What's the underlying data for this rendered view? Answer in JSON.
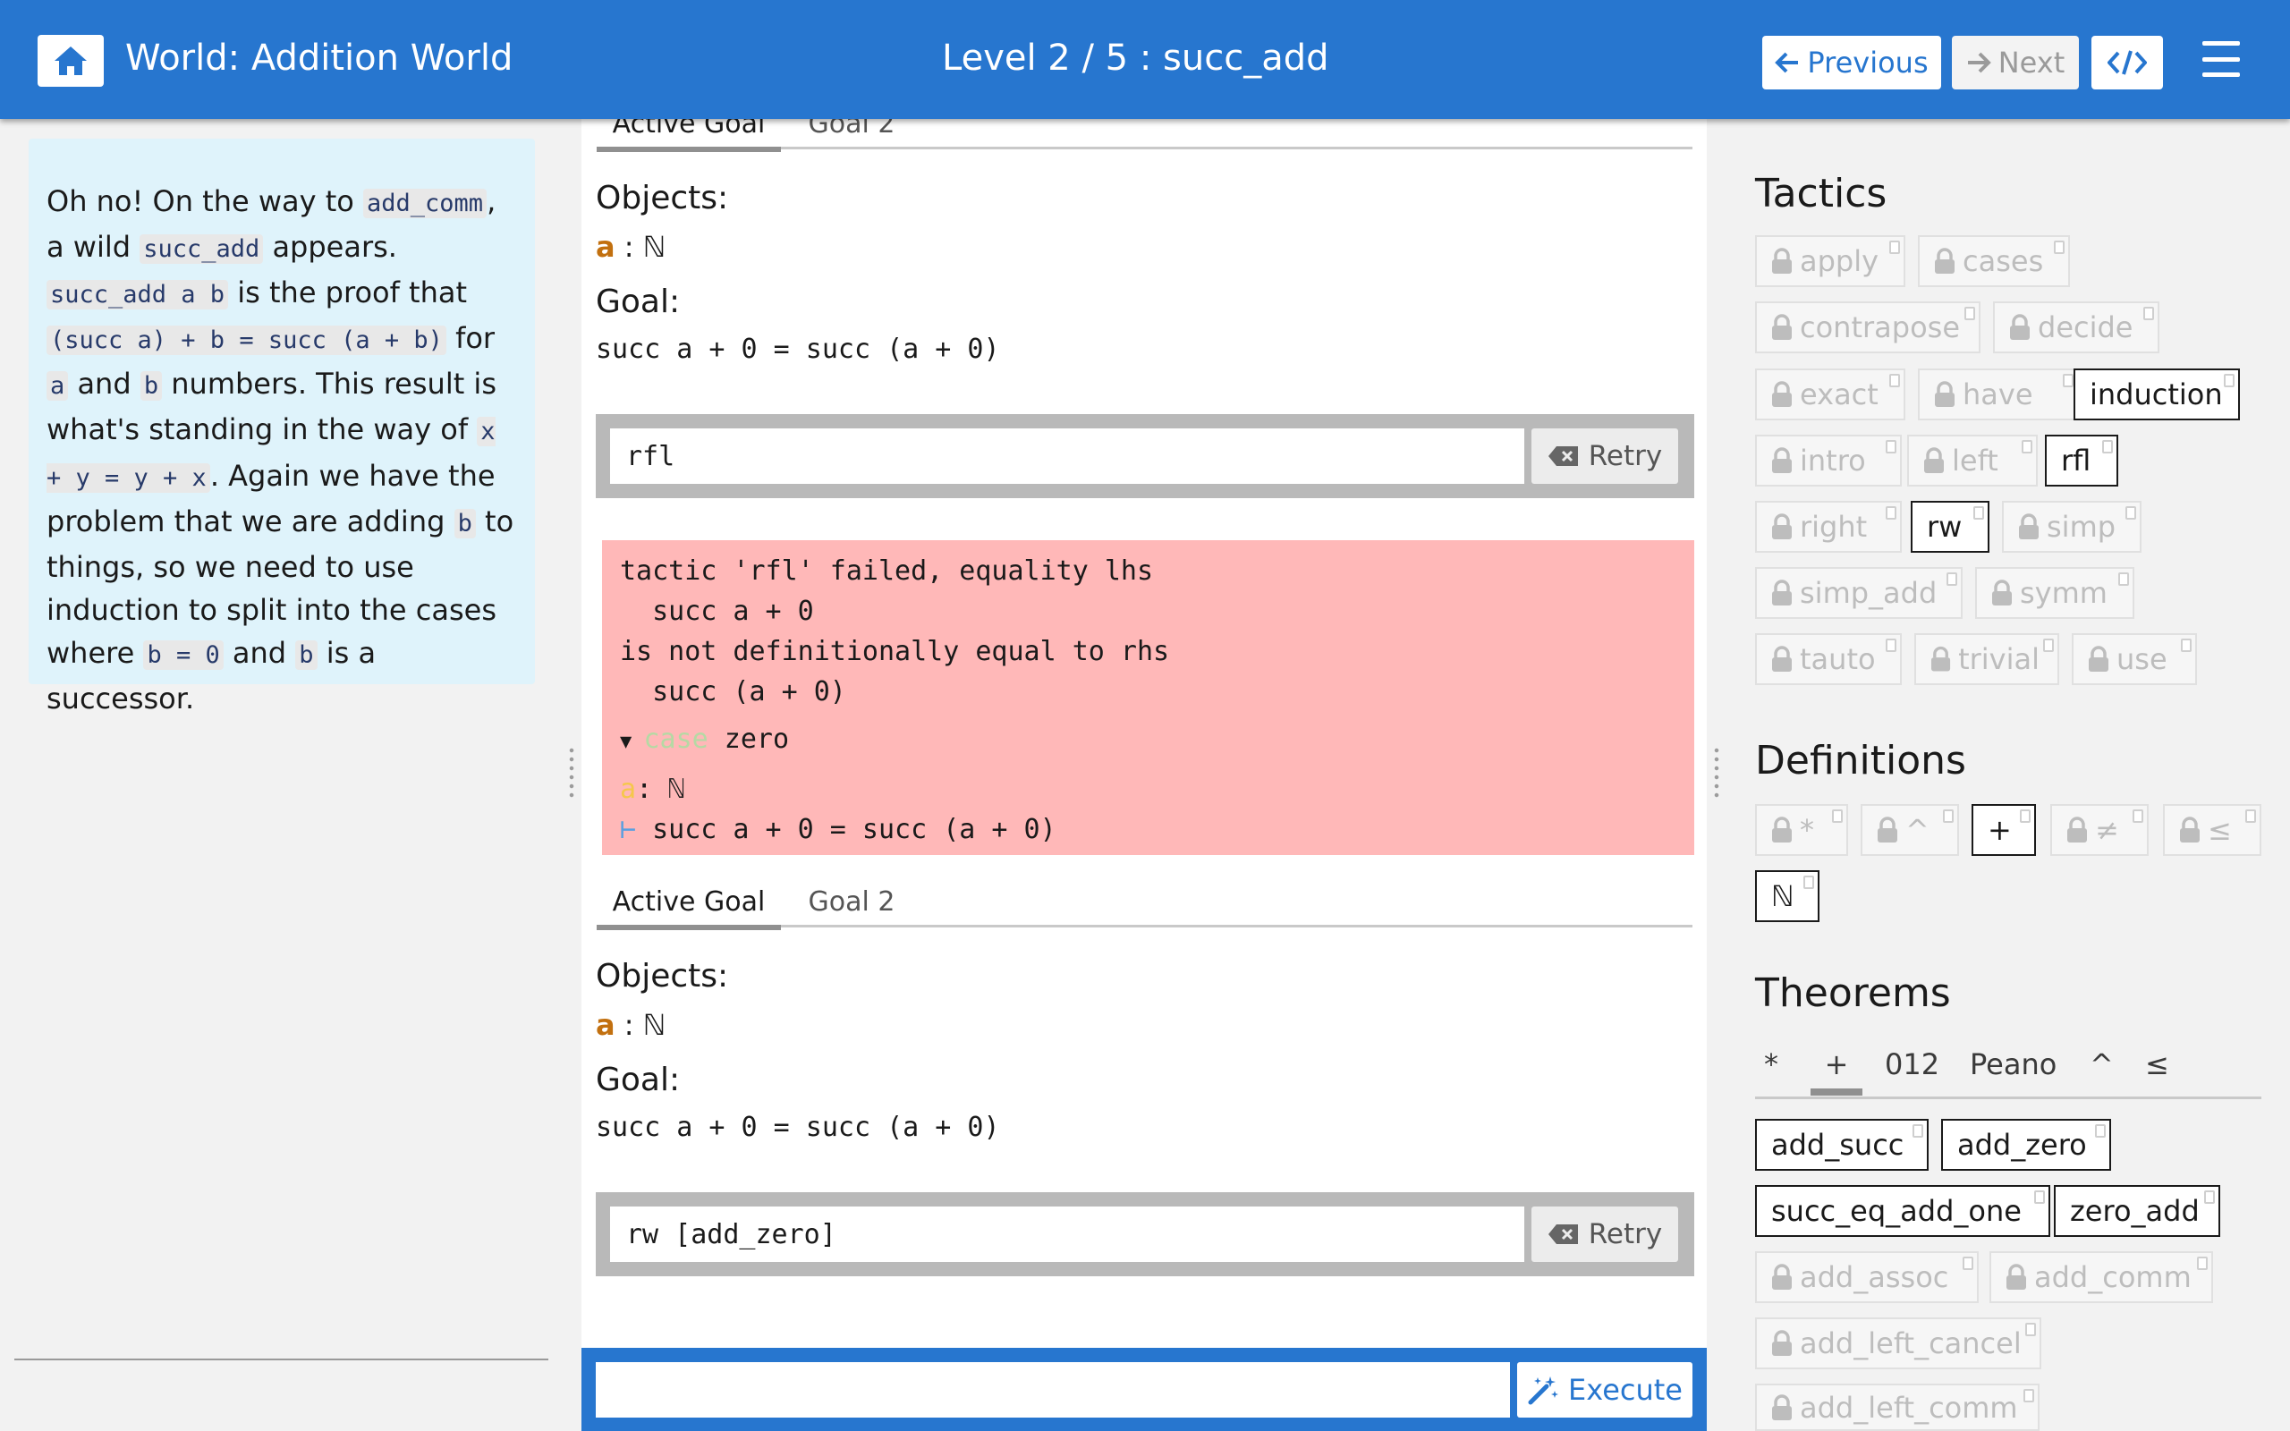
{
  "header": {
    "world_title": "World: Addition World",
    "level_title": "Level 2 / 5 : succ_add",
    "previous_label": "Previous",
    "next_label": "Next",
    "home_icon": "home-icon",
    "code_icon": "code-icon",
    "menu_icon": "hamburger-menu-icon",
    "accent_color": "#2776cf"
  },
  "intro": {
    "t1": "Oh no! On the way to ",
    "c1": "add_comm",
    "t2": ", a wild ",
    "c2": "succ_add",
    "t3": " appears. ",
    "c3": "succ_add a b",
    "t4": " is the proof that ",
    "c4": "(succ a) + b = succ (a + b)",
    "t5": " for ",
    "c5": "a",
    "t6": " and ",
    "c6": "b",
    "t7": " numbers. This result is what's standing in the way of ",
    "c7": "x + y = y + x",
    "t8": ". Again we have the problem that we are adding ",
    "c8": "b",
    "t9": " to things, so we need to use induction to split into the cases where ",
    "c9": "b = 0",
    "t10": " and ",
    "c10": "b",
    "t11": " is a successor."
  },
  "center": {
    "tabs": {
      "active": "Active Goal",
      "second": "Goal 2"
    },
    "objects_label": "Objects:",
    "goal_label": "Goal:",
    "hyp_var": "a",
    "hyp_sep": " : ",
    "hyp_type": "ℕ",
    "goal_text": "succ a + 0 = succ (a + 0)",
    "step1": {
      "command": "rfl",
      "retry_label": "Retry"
    },
    "error": {
      "line1": "tactic 'rfl' failed, equality lhs",
      "line2": "  succ a + 0",
      "line3": "is not definitionally equal to rhs",
      "line4": "  succ (a + 0)",
      "case_kw": "case",
      "case_name": " zero",
      "sub_var": "a",
      "sub_type": ": ℕ",
      "turnstile": "⊢",
      "sub_goal": " succ a + 0 = succ (a + 0)"
    },
    "step2": {
      "command": "rw [add_zero]",
      "retry_label": "Retry"
    },
    "execute_label": "Execute",
    "execute_icon": "magic-wand-icon"
  },
  "right": {
    "tactics_title": "Tactics",
    "tactics": [
      {
        "label": "apply",
        "locked": true
      },
      {
        "label": "cases",
        "locked": true
      },
      {
        "label": "contrapose",
        "locked": true
      },
      {
        "label": "decide",
        "locked": true
      },
      {
        "label": "exact",
        "locked": true
      },
      {
        "label": "have",
        "locked": true
      },
      {
        "label": "induction",
        "locked": false
      },
      {
        "label": "intro",
        "locked": true
      },
      {
        "label": "left",
        "locked": true
      },
      {
        "label": "rfl",
        "locked": false
      },
      {
        "label": "right",
        "locked": true
      },
      {
        "label": "rw",
        "locked": false
      },
      {
        "label": "simp",
        "locked": true
      },
      {
        "label": "simp_add",
        "locked": true
      },
      {
        "label": "symm",
        "locked": true
      },
      {
        "label": "tauto",
        "locked": true
      },
      {
        "label": "trivial",
        "locked": true
      },
      {
        "label": "use",
        "locked": true
      }
    ],
    "definitions_title": "Definitions",
    "definitions": [
      {
        "label": "*",
        "locked": true
      },
      {
        "label": "^",
        "locked": true
      },
      {
        "label": "+",
        "locked": false
      },
      {
        "label": "≠",
        "locked": true
      },
      {
        "label": "≤",
        "locked": true
      },
      {
        "label": "ℕ",
        "locked": false
      }
    ],
    "theorems_title": "Theorems",
    "theorem_tabs": [
      "*",
      "+",
      "012",
      "Peano",
      "^",
      "≤"
    ],
    "theorems": [
      {
        "label": "add_succ",
        "locked": false
      },
      {
        "label": "add_zero",
        "locked": false
      },
      {
        "label": "succ_eq_add_one",
        "locked": false
      },
      {
        "label": "zero_add",
        "locked": false
      },
      {
        "label": "add_assoc",
        "locked": true
      },
      {
        "label": "add_comm",
        "locked": true
      },
      {
        "label": "add_left_cancel",
        "locked": true
      },
      {
        "label": "add_left_comm",
        "locked": true
      }
    ]
  }
}
